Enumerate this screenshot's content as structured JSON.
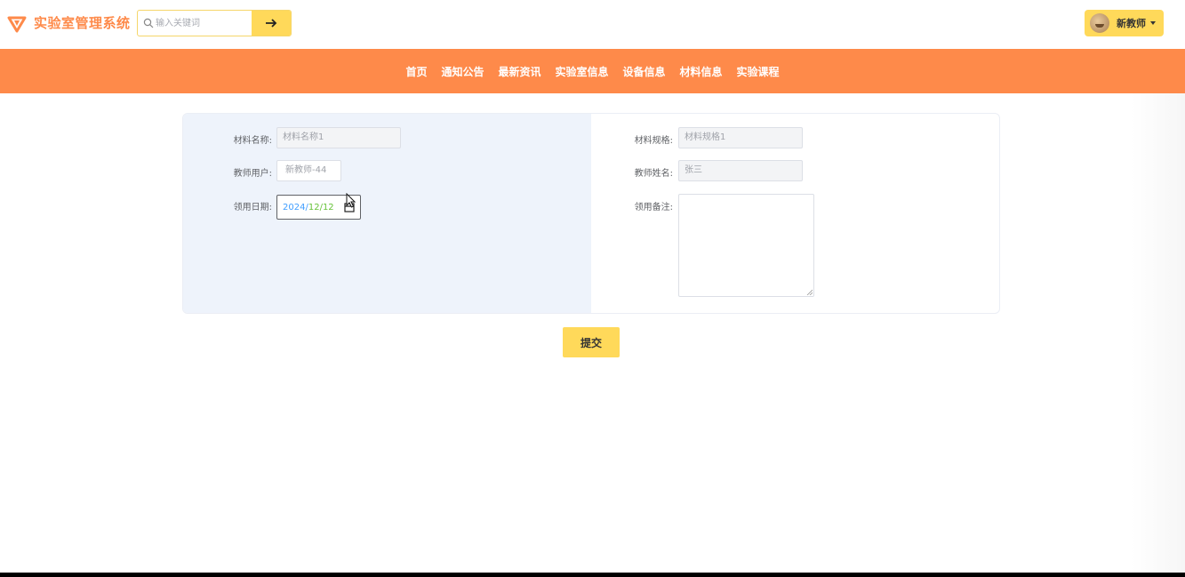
{
  "app": {
    "title": "实验室管理系统",
    "accent_color": "#fe8a4a",
    "highlight_color": "#ffd95a"
  },
  "search": {
    "placeholder": "输入关键词",
    "value": "",
    "button_icon": "arrow-right-icon"
  },
  "user": {
    "name": "新教师",
    "avatar_icon": "avatar"
  },
  "nav": {
    "items": [
      "首页",
      "通知公告",
      "最新资讯",
      "实验室信息",
      "设备信息",
      "材料信息",
      "实验课程"
    ]
  },
  "form": {
    "material_name": {
      "label": "材料名称:",
      "value": "材料名称1"
    },
    "material_spec": {
      "label": "材料规格:",
      "value": "材料规格1"
    },
    "teacher_user": {
      "label": "教师用户:",
      "value": "新教师-44"
    },
    "teacher_name": {
      "label": "教师姓名:",
      "value": "张三"
    },
    "receive_date": {
      "label": "领用日期:",
      "year": "2024",
      "month": "12",
      "day": "12",
      "sep": "/"
    },
    "remark": {
      "label": "领用备注:",
      "value": ""
    },
    "submit_label": "提交"
  }
}
